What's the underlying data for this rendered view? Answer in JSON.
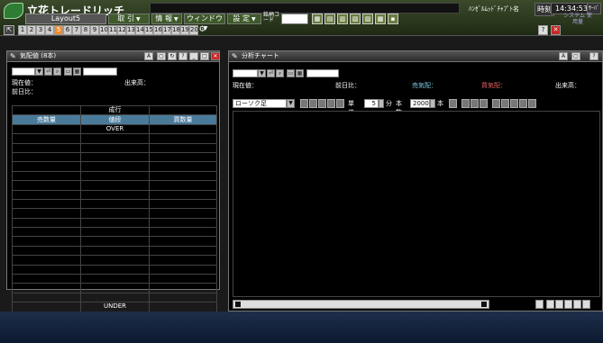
{
  "app": {
    "title": "立花トレードリッチ",
    "layout": "Layout5",
    "clock_label": "ﾊﾝｾﾞﾙﾑｯﾄﾞﾁｬﾌﾟﾄ名",
    "time_label": "時刻",
    "time": "14:34:53",
    "close_label": "ｻｰﾊﾞ"
  },
  "menu": {
    "trade": "取 引",
    "info": "情 報",
    "window": "ウィンドウ",
    "settings": "設 定",
    "code_label": "銘柄コード",
    "system": "システム 使用量"
  },
  "layout_tabs": [
    "1",
    "2",
    "3",
    "4",
    "5",
    "6",
    "7",
    "8",
    "9",
    "10",
    "11",
    "12",
    "13",
    "14",
    "15",
    "16",
    "17",
    "18",
    "19",
    "20"
  ],
  "active_tab": 4,
  "quote_board": {
    "title": "気配値 (8本)",
    "current_price_label": "現在値：",
    "volume_label": "出来高：",
    "prev_day_label": "前日比：",
    "market_label": "成行",
    "col_sell": "売数量",
    "col_price": "値段",
    "col_buy": "買数量",
    "over": "OVER",
    "under": "UNDER"
  },
  "chart": {
    "title": "分析チャート",
    "current_price_label": "現在値：",
    "prev_day_label": "前日比：",
    "sell_quote_label": "売気配：",
    "buy_quote_label": "買気配：",
    "volume_label": "出来高：",
    "chart_type": "ローソク足",
    "unit_label": "単位",
    "unit_value": "5",
    "minute_label": "分",
    "count_label": "本数",
    "count_value": "2000",
    "count_suffix": "本"
  },
  "colors": {
    "accent": "#f28c28",
    "sell": "#7ec8e3",
    "buy": "#e06060"
  }
}
